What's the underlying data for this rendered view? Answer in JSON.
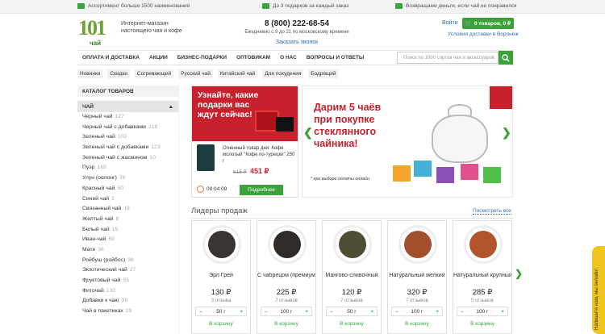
{
  "topbar": {
    "assortment": "Ассортимент больше 1500 наименований",
    "gifts": "До 3 подарков за каждый заказ",
    "refund": "Возвращаем деньги, если чай не понравился"
  },
  "header": {
    "logo_text": "чай",
    "tagline_1": "Интернет-магазин",
    "tagline_2": "настоящего чая и кофе",
    "phone": "8 (800) 222-68-54",
    "hours": "Ежедневно с 9 до 21 по московскому времени",
    "callback": "Заказать звонок",
    "login": "Войти",
    "cart": "0 товаров, 0 ₽",
    "delivery": "Условия доставки в Воронеж"
  },
  "nav": [
    "ОПЛАТА И ДОСТАВКА",
    "АКЦИИ",
    "БИЗНЕС-ПОДАРКИ",
    "ОПТОВИКАМ",
    "О НАС",
    "ВОПРОСЫ И ОТВЕТЫ"
  ],
  "search": {
    "placeholder": "Поиск по 1000 сортов чая и аксессуаров"
  },
  "tags": [
    "Новинки",
    "Скидки",
    "Согревающий",
    "Русский чай",
    "Китайский чай",
    "Для похудения",
    "Бодрящий"
  ],
  "sidebar": {
    "header": "КАТАЛОГ ТОВАРОВ",
    "category": "ЧАЙ",
    "items": [
      {
        "name": "Черный чай",
        "count": "127"
      },
      {
        "name": "Черный чай с добавками",
        "count": "218"
      },
      {
        "name": "Зеленый чай",
        "count": "102"
      },
      {
        "name": "Зеленый чай с добавками",
        "count": "123"
      },
      {
        "name": "Зеленый чай с жасмином",
        "count": "10"
      },
      {
        "name": "Пуэр",
        "count": "169"
      },
      {
        "name": "Улун (оолонг)",
        "count": "76"
      },
      {
        "name": "Красный чай",
        "count": "50"
      },
      {
        "name": "Синий чай",
        "count": "2"
      },
      {
        "name": "Связанный чай",
        "count": "19"
      },
      {
        "name": "Желтый чай",
        "count": "6"
      },
      {
        "name": "Белый чай",
        "count": "15"
      },
      {
        "name": "Иван-чай",
        "count": "59"
      },
      {
        "name": "Мате",
        "count": "36"
      },
      {
        "name": "Ройбуш (ройбос)",
        "count": "36"
      },
      {
        "name": "Экзотический чай",
        "count": "27"
      },
      {
        "name": "Фруктовый чай",
        "count": "55"
      },
      {
        "name": "Фиточай",
        "count": "130"
      },
      {
        "name": "Добавки к чаю",
        "count": "39"
      },
      {
        "name": "Чай в пакетиках",
        "count": "29"
      }
    ]
  },
  "promo": {
    "title": "Узнайте, какие подарки вас ждут сейчас!",
    "offer": "Огненный товар дня: Кофе молотый \"Кофе по-турецки\" 250 г",
    "old_price": "615 ₽",
    "new_price": "451 ₽",
    "timer": "08:04:09",
    "button": "Подробнее"
  },
  "banner": {
    "title": "Дарим 5 чаёв при покупке стеклянного чайника!",
    "footnote": "* при выборе оплаты онлайн"
  },
  "bestsellers": {
    "title": "Лидеры продаж",
    "more": "Посмотреть все",
    "items": [
      {
        "name": "Эрл Грей",
        "price": "130 ₽",
        "reviews": "3 отзыва",
        "qty": "50 г",
        "add": "В корзину",
        "color": "#3a3430"
      },
      {
        "name": "С чабрецом (премиум)",
        "price": "225 ₽",
        "reviews": "7 отзывов",
        "qty": "100 г",
        "add": "В корзину",
        "color": "#2f2b27"
      },
      {
        "name": "Мангово-сливочный",
        "price": "120 ₽",
        "reviews": "7 отзывов",
        "qty": "50 г",
        "add": "В корзину",
        "color": "#4f4d33"
      },
      {
        "name": "Натуральный мелкий",
        "price": "320 ₽",
        "reviews": "7 отзывов",
        "qty": "100 г",
        "add": "В корзину",
        "color": "#a2502c"
      },
      {
        "name": "Натуральный крупный",
        "price": "285 ₽",
        "reviews": "5 отзывов",
        "qty": "100 г",
        "add": "В корзину",
        "color": "#b2552d"
      }
    ]
  },
  "feedback": "Напишите нам, мы онлайн!",
  "colors": {
    "accent": "#3ca33a",
    "promo_red": "#c8202c",
    "link": "#2a6fb0"
  }
}
